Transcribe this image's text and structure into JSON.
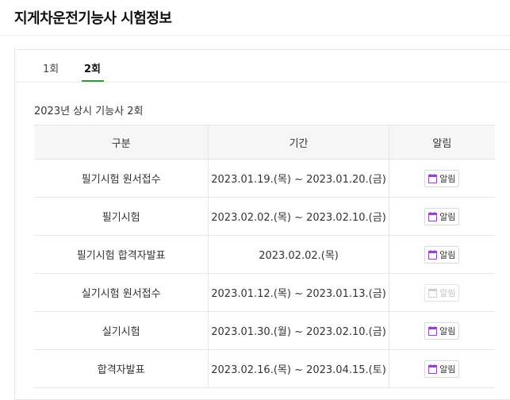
{
  "page": {
    "title": "지게차운전기능사 시험정보"
  },
  "tabs": [
    {
      "label": "1회",
      "active": false
    },
    {
      "label": "2회",
      "active": true
    }
  ],
  "session": {
    "title": "2023년 상시 기능사 2회"
  },
  "table": {
    "headers": [
      "구분",
      "기간",
      "알림"
    ],
    "rows": [
      {
        "type": "필기시험 원서접수",
        "period": "2023.01.19.(목) ~ 2023.01.20.(금)",
        "alarm": "알림",
        "alarm_enabled": true
      },
      {
        "type": "필기시험",
        "period": "2023.02.02.(목) ~ 2023.02.10.(금)",
        "alarm": "알림",
        "alarm_enabled": true
      },
      {
        "type": "필기시험 합격자발표",
        "period": "2023.02.02.(목)",
        "alarm": "알림",
        "alarm_enabled": true
      },
      {
        "type": "실기시험 원서접수",
        "period": "2023.01.12.(목) ~ 2023.01.13.(금)",
        "alarm": "알림",
        "alarm_enabled": false
      },
      {
        "type": "실기시험",
        "period": "2023.01.30.(월) ~ 2023.02.10.(금)",
        "alarm": "알림",
        "alarm_enabled": true
      },
      {
        "type": "합격자발표",
        "period": "2023.02.16.(목) ~ 2023.04.15.(토)",
        "alarm": "알림",
        "alarm_enabled": true
      }
    ]
  },
  "colors": {
    "accent": "#2e9e3b",
    "calendar_icon": "#8a4bbf",
    "calendar_icon_disabled": "#cfcfcf"
  },
  "icons": {
    "alarm": "calendar-icon"
  }
}
